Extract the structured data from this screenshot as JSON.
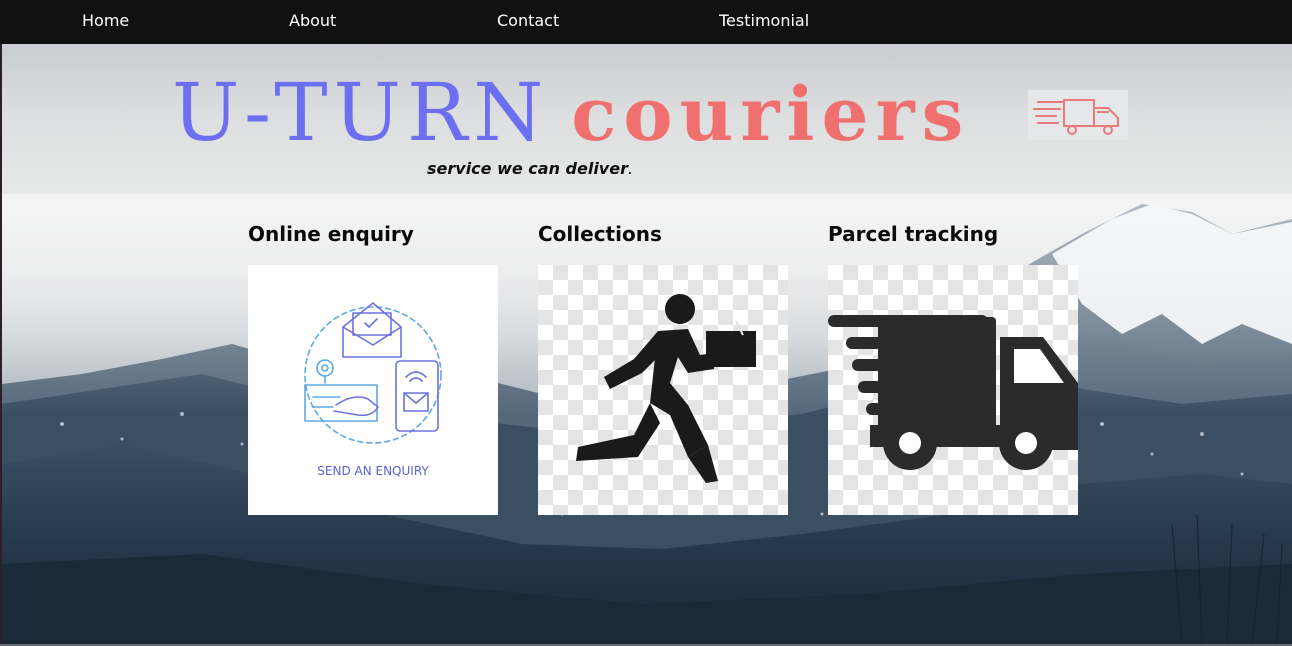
{
  "nav": {
    "items": [
      {
        "label": "Home"
      },
      {
        "label": "About"
      },
      {
        "label": "Contact"
      },
      {
        "label": "Testimonial"
      }
    ]
  },
  "brand": {
    "part1": "U-TURN",
    "part2": "couriers",
    "color_part1": "#6c6ff0",
    "color_part2": "#f07070",
    "logo_icon": "delivery-truck-icon"
  },
  "tagline": {
    "text": "service we can deliver",
    "punct": "."
  },
  "cards": [
    {
      "title": "Online enquiry",
      "image_icon": "send-enquiry-icon",
      "image_caption": "SEND AN ENQUIRY"
    },
    {
      "title": "Collections",
      "image_icon": "courier-running-icon"
    },
    {
      "title": "Parcel tracking",
      "image_icon": "delivery-truck-icon"
    }
  ]
}
